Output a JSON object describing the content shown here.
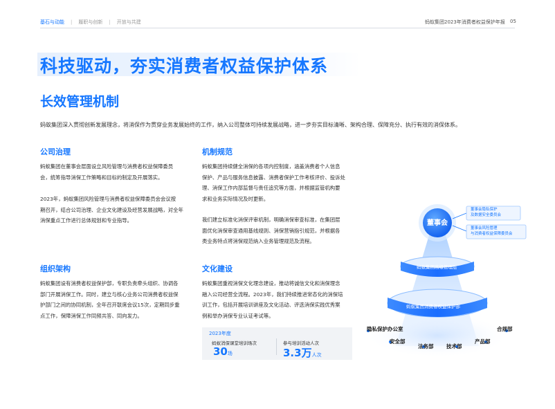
{
  "header": {
    "nav": [
      "基石与动能",
      "履职与创新",
      "开放与共建"
    ],
    "doc_title": "蚂蚁集团2023年消费者权益保护年报",
    "page_number": "05"
  },
  "title": "科技驱动，夯实消费者权益保护体系",
  "subtitle": "长效管理机制",
  "intro": "蚂蚁集团深入贯彻创新发展理念，将消保作为贯穿业务发展始终的工作，纳入公司整体可持续发展战略，进一步夯实目标清晰、架构合理、保障充分、执行有效的消保体系。",
  "sections": {
    "governance": {
      "heading": "公司治理",
      "p1": [
        "蚂蚁集团在董事会层面设立风险管理与消费者权益保障委员",
        "会，统筹指导消保工作策略和目标的制定及开展落实。"
      ],
      "p2": [
        "2023年，蚂蚁集团风险管理与消费者权益保障委员会会议按",
        "期召开，结合公司治理、企业文化建设及经营发展战略，对全年",
        "消保重点工作进行总体规划和专业指导。"
      ]
    },
    "mechanism": {
      "heading": "机制规范",
      "p1": [
        "蚂蚁集团持续健全消保的各项内控制度，涵盖消费者个人信息",
        "保护、产品与服务信息披露、消费者保护工作考核评价、投诉处",
        "理、消保工作内部监督与责任追究等方面，并根据监管机构要",
        "求和业务实际情况及时更新。"
      ],
      "p2": [
        "我们建立标准化消保评审机制，明确消保审查标准，在集团层",
        "面优化消保审查通用基线规则、消保营销指引规范，并根据各",
        "类业务特点将消保规范纳入业务管理规范及流程。"
      ]
    },
    "organization": {
      "heading": "组织架构",
      "p1": [
        "蚂蚁集团设有消费者权益保护部，专职负责牵头组织、协调各",
        "部门开展消保工作。同时，建立与核心业务公司消费者权益保",
        "护部门之间的协同机制，全年召开联席会议15次，定期同步重",
        "点工作，保障消保工作同频共答、同向发力。"
      ]
    },
    "culture": {
      "heading": "文化建设",
      "p1": [
        "蚂蚁集团重视消保文化理念建设，推动将诚信文化和消保理念",
        "融入公司经营全流程。2023年，我们持续推进常态化的消保培",
        "训工作，包括开展培训讲座及文化活动、评选消保实践优秀案",
        "例和举办消保专业认证考试等。"
      ]
    }
  },
  "stats": {
    "year": "2023年度",
    "items": [
      {
        "label": "蚂蚁消保课堂培训场次",
        "value": "30",
        "unit": "场"
      },
      {
        "label": "参与培训活动人次",
        "value": "3.3万",
        "unit": "人次"
      }
    ]
  },
  "diagram": {
    "board": "董事会",
    "board_committees": [
      [
        "董事会隐私保护",
        "及数据安全委员会"
      ],
      [
        "董事会风险管理",
        "与消费者权益保障委员会"
      ]
    ],
    "ring_top": "蚂蚁集团高级管理层",
    "ring_bottom": "蚂蚁集团消费者权益保护部",
    "departments": [
      "隐私保护办公室",
      "安全部",
      "法务部",
      "技术部",
      "产品部",
      "合规部"
    ]
  }
}
